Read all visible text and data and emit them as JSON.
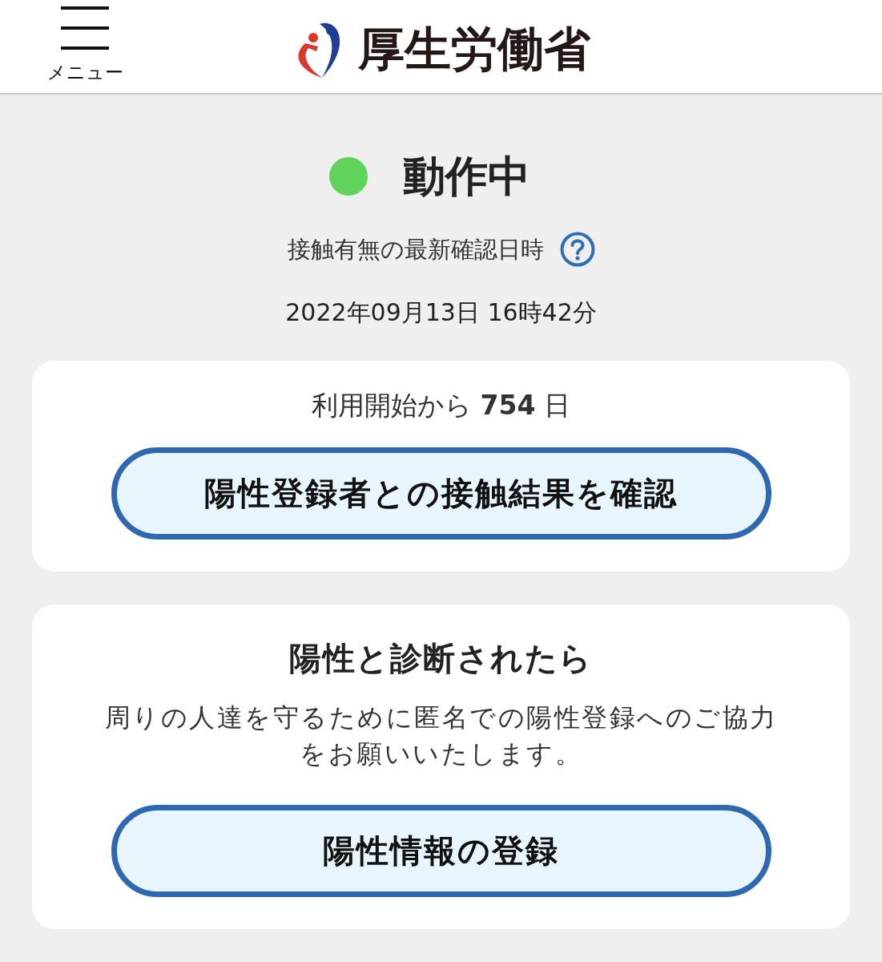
{
  "header": {
    "menu": {
      "label": "メニュー"
    },
    "logo": {
      "text": "厚生労働省"
    }
  },
  "status": {
    "label": "動作中",
    "active": true
  },
  "last_check": {
    "label": "接触有無の最新確認日時",
    "datetime": "2022年09月13日 16時42分"
  },
  "cards": [
    {
      "kind": "usage",
      "usage_text": "利用開始から **754** 日",
      "button": "陽性登録者との接触結果を確認"
    },
    {
      "kind": "register",
      "title": "陽性と診断されたら",
      "text": "周りの人達を守るために匿名での陽性登録へのご協力をお願いいたします。",
      "button": "陽性情報の登録"
    }
  ]
}
